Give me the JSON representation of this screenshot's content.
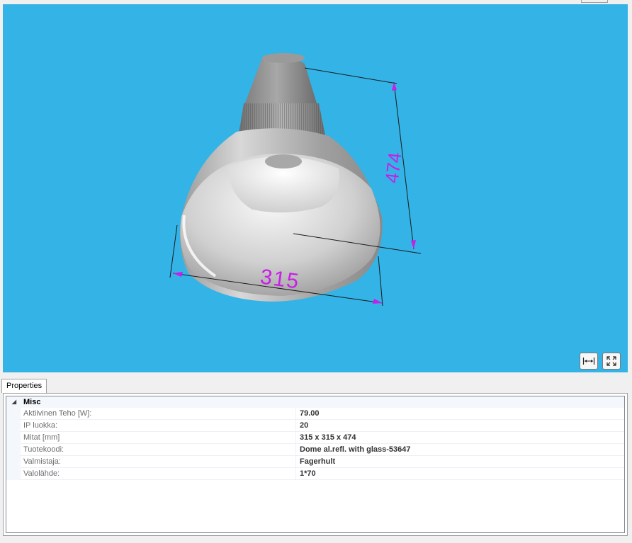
{
  "viewport": {
    "background_color": "#33b3e6",
    "dimensions": {
      "height_label": "474",
      "width_label": "315",
      "label_color": "#c81ee6"
    },
    "toolbar": {
      "measure_icon": "measure-dimensions-icon",
      "fit_icon": "fit-to-view-icon"
    }
  },
  "properties": {
    "tab_label": "Properties",
    "category": {
      "name": "Misc",
      "toggle_glyph": "◢"
    },
    "rows": [
      {
        "name": "Aktiivinen Teho [W]:",
        "value": "79.00"
      },
      {
        "name": "IP luokka:",
        "value": "20"
      },
      {
        "name": "Mitat [mm]",
        "value": "315 x 315 x 474"
      },
      {
        "name": "Tuotekoodi:",
        "value": "Dome al.refl. with glass-53647"
      },
      {
        "name": "Valmistaja:",
        "value": "Fagerhult"
      },
      {
        "name": "Valolähde:",
        "value": "1*70"
      }
    ]
  }
}
